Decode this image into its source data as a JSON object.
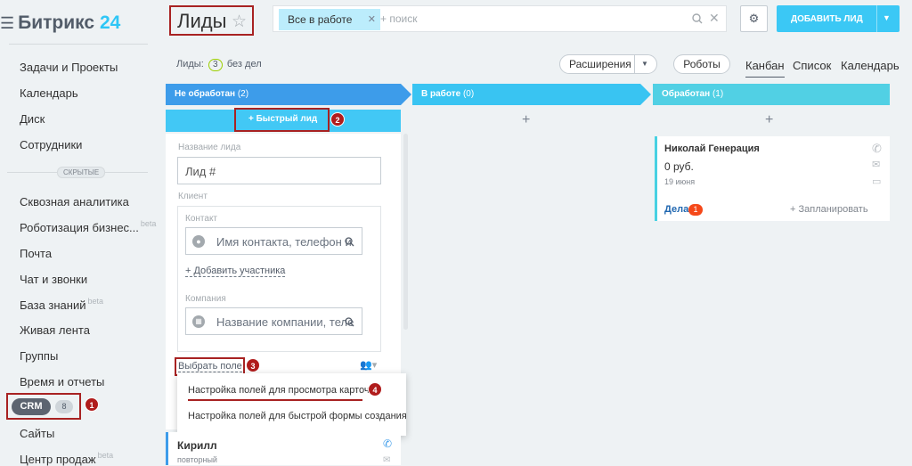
{
  "sidebar": {
    "logo_text": "Битрикс",
    "logo_num": "24",
    "items_top": [
      "Задачи и Проекты",
      "Календарь",
      "Диск",
      "Сотрудники"
    ],
    "hidden_label": "СКРЫТЫЕ",
    "items_bottom": [
      "Сквозная аналитика",
      "Роботизация бизнес...",
      "Почта",
      "Чат и звонки",
      "База знаний",
      "Живая лента",
      "Группы",
      "Время и отчеты"
    ],
    "beta_label": "beta",
    "crm_label": "CRM",
    "crm_count": "8",
    "items_after": [
      "Сайты",
      "Центр продаж"
    ]
  },
  "header": {
    "title": "Лиды",
    "filter_tag": "Все в работе",
    "search_placeholder": "+ поиск",
    "add_button": "ДОБАВИТЬ ЛИД"
  },
  "toolbar": {
    "leads_prefix": "Лиды:",
    "leads_count": "3",
    "leads_suffix": "без дел",
    "extensions": "Расширения",
    "robots": "Роботы",
    "views": [
      "Канбан",
      "Список",
      "Календарь"
    ]
  },
  "columns": [
    {
      "title": "Не обработан",
      "count": "(2)",
      "color": "#3d9cea"
    },
    {
      "title": "В работе",
      "count": "(0)",
      "color": "#39c4f2"
    },
    {
      "title": "Обработан",
      "count": "(1)",
      "color": "#51d0e4"
    }
  ],
  "quick_lead": {
    "button": "+ Быстрый лид",
    "name_label": "Название лида",
    "name_value": "Лид #",
    "client_label": "Клиент",
    "contact_label": "Контакт",
    "contact_placeholder": "Имя контакта, телефон и",
    "add_participant": "+ Добавить участника",
    "company_label": "Компания",
    "company_placeholder": "Название компании, теле",
    "choose_field": "Выбрать поле"
  },
  "dropdown": {
    "item1": "Настройка полей для просмотра карточки",
    "item2": "Настройка полей для быстрой формы создания"
  },
  "card_kirill": {
    "name": "Кирилл",
    "status": "повторный"
  },
  "card_nikolay": {
    "name": "Николай Генерация",
    "amount": "0 руб.",
    "date": "19 июня",
    "deals_label": "Дела",
    "deals_count": "1",
    "plan": "+ Запланировать"
  },
  "annotations": [
    "1",
    "2",
    "3",
    "4"
  ],
  "colors": {
    "accent": "#3bc8f5",
    "annotation_red": "#b01c1c"
  }
}
